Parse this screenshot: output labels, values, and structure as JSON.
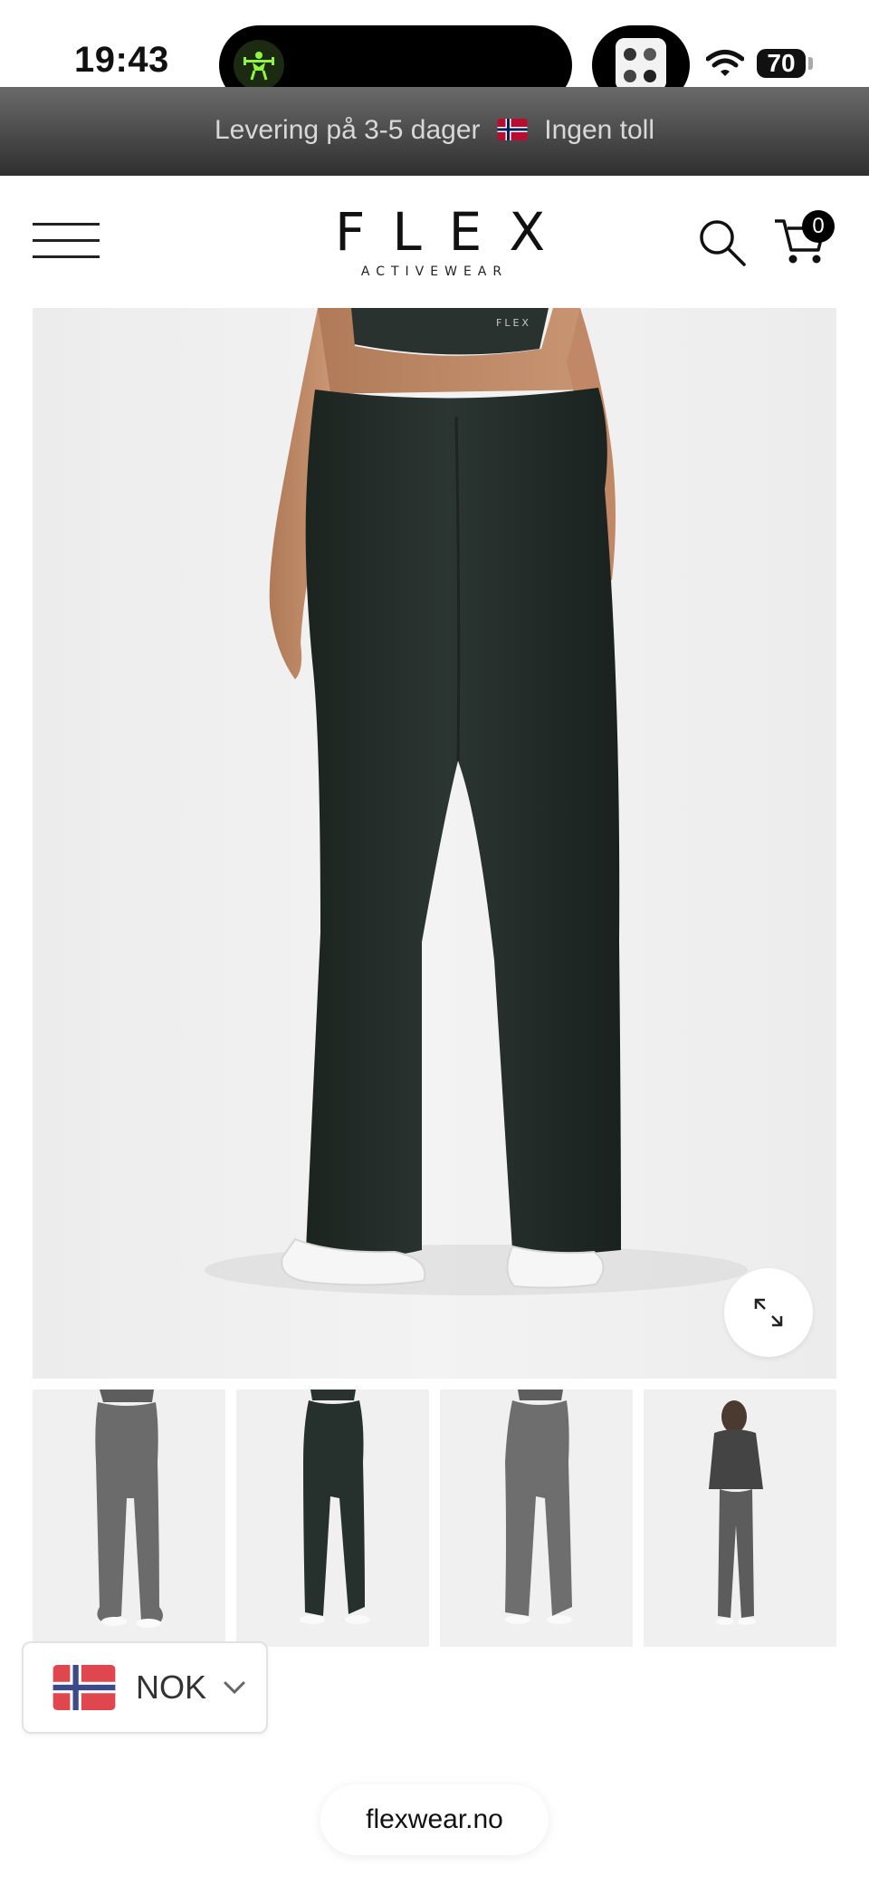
{
  "status_bar": {
    "time": "19:43",
    "battery": "70"
  },
  "announcement": {
    "text_before": "Levering på 3-5 dager",
    "text_after": "Ingen toll",
    "flag_icon": "norway-flag-icon"
  },
  "header": {
    "logo_main": "FLEX",
    "logo_sub": "ACTIVEWEAR",
    "cart_count": "0",
    "icons": [
      "hamburger-menu-icon",
      "search-icon",
      "cart-icon"
    ]
  },
  "product": {
    "main_image": "dark-green-wide-leg-pants-back-view",
    "expand_icon": "expand-arrows-icon",
    "thumbnails": [
      {
        "name": "grey-pants-front-view",
        "color": "#6b6b6b"
      },
      {
        "name": "dark-green-pants-back-view",
        "color": "#26302c"
      },
      {
        "name": "grey-pants-front-full",
        "color": "#6e6e6e"
      },
      {
        "name": "grey-full-outfit-view",
        "color": "#5c5c5c"
      }
    ]
  },
  "currency": {
    "code": "NOK",
    "flag_icon": "norway-flag-icon",
    "chevron_icon": "chevron-down-icon"
  },
  "browser": {
    "url": "flexwear.no"
  },
  "colors": {
    "announcement_bg": "#3a3a3a",
    "pants_dark_green": "#26302c",
    "thumbnail_grey": "#6b6b6b"
  }
}
